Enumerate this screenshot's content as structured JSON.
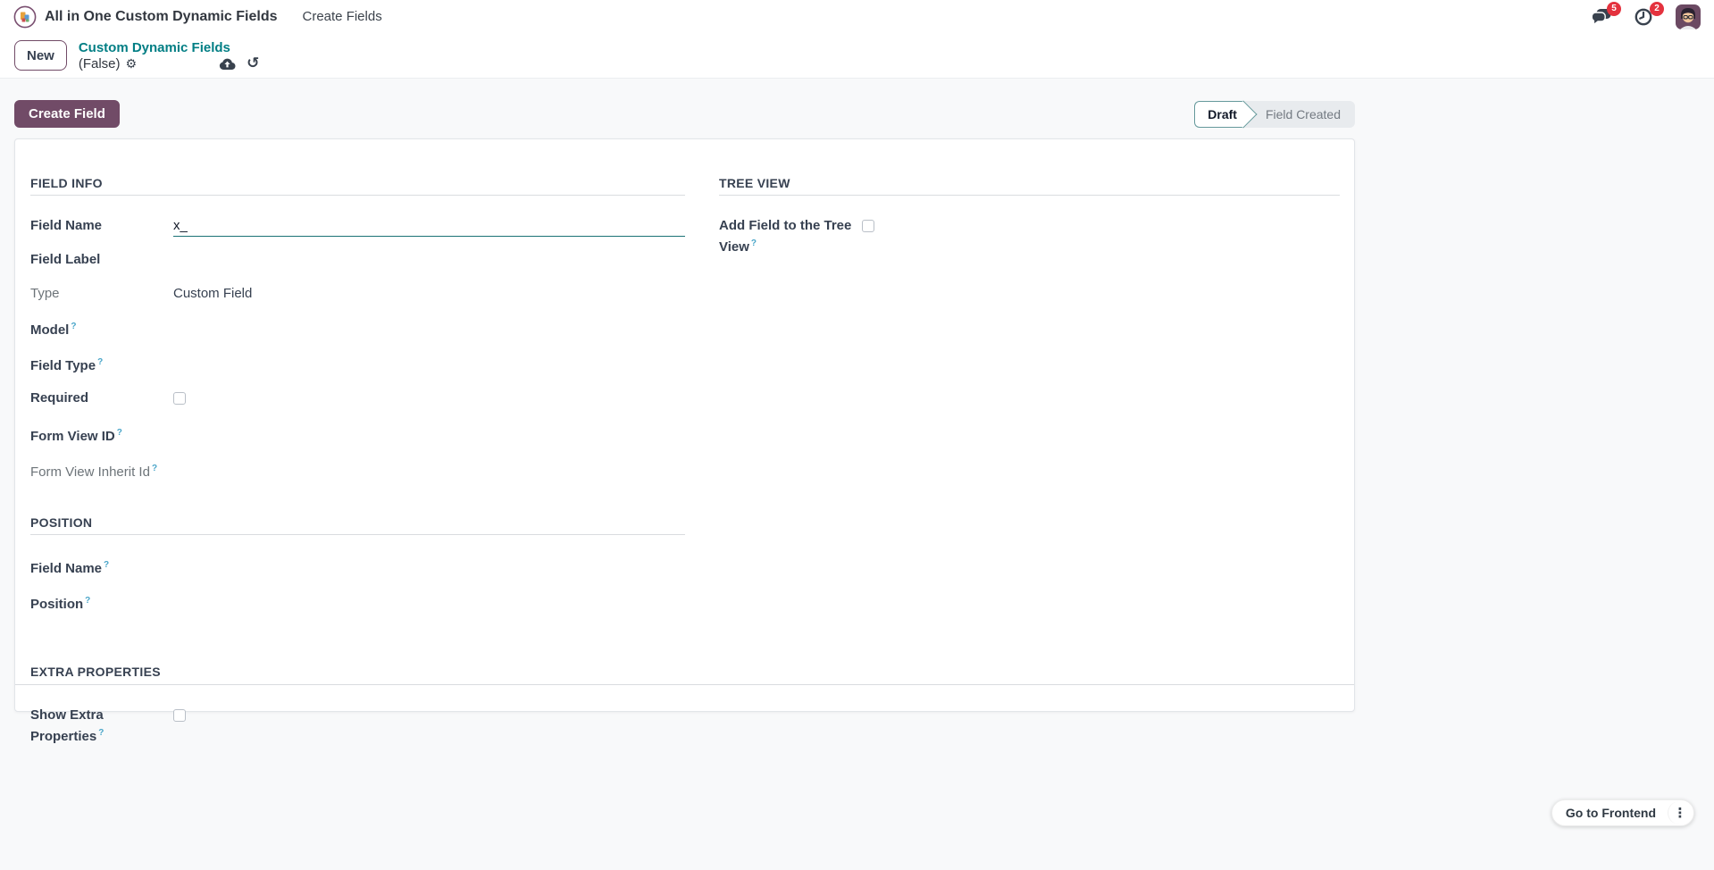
{
  "navbar": {
    "app_title": "All in One Custom Dynamic Fields",
    "menu_item": "Create Fields",
    "message_count": "5",
    "activity_count": "2"
  },
  "control_panel": {
    "new_button": "New",
    "breadcrumb": "Custom Dynamic Fields",
    "record_name": "(False)"
  },
  "icons": {
    "gear": "⚙",
    "undo": "↺",
    "kebab": "⋮"
  },
  "actions": {
    "create_field": "Create Field"
  },
  "statusbar": {
    "draft": "Draft",
    "field_created": "Field Created"
  },
  "form": {
    "help_marker": "?",
    "field_info": {
      "title": "FIELD INFO",
      "field_name_label": "Field Name",
      "field_name_value": "x_",
      "field_label_label": "Field Label",
      "type_label": "Type",
      "type_value": "Custom Field",
      "model_label": "Model",
      "field_type_label": "Field Type",
      "required_label": "Required",
      "form_view_id_label": "Form View ID",
      "form_view_inherit_id_label": "Form View Inherit Id"
    },
    "position": {
      "title": "POSITION",
      "field_name_label": "Field Name",
      "position_label": "Position"
    },
    "extra": {
      "title": "EXTRA PROPERTIES",
      "show_extra_label": "Show Extra Properties"
    },
    "tree": {
      "title": "TREE VIEW",
      "add_field_label": "Add Field to the Tree View"
    }
  },
  "footer": {
    "go_to_frontend": "Go to Frontend"
  },
  "colors": {
    "primary": "#714B67",
    "teal": "#017E84",
    "badge_red": "#E4323E",
    "body_bg": "#F8F9FA"
  }
}
